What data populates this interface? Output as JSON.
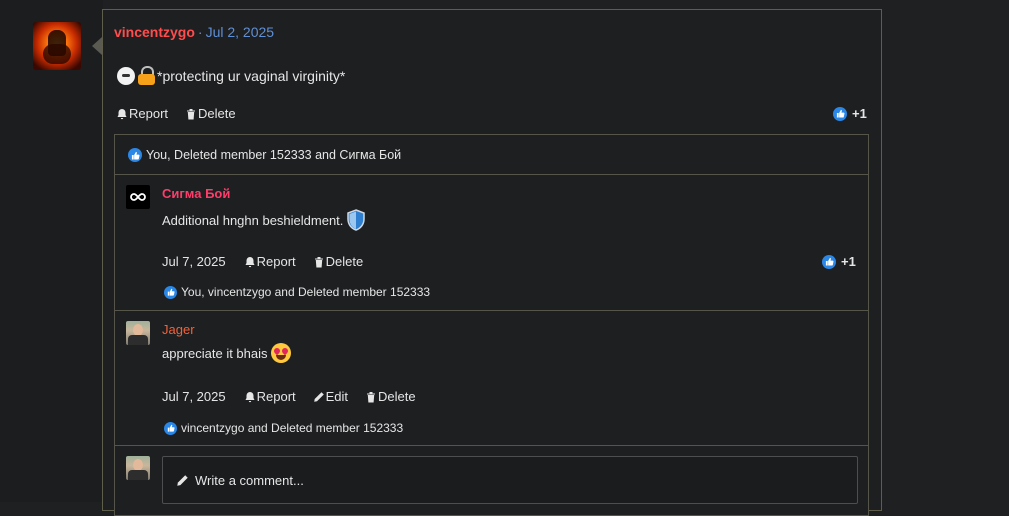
{
  "post": {
    "username": "vincentzygo",
    "separator": "·",
    "date": "Jul 2, 2025",
    "body_text": "*protecting ur vaginal virginity*",
    "actions": {
      "report": "Report",
      "delete": "Delete"
    },
    "reaction_count": "+1"
  },
  "reactions_bar": {
    "text": "You, Deleted member 152333 and Сигма Бой"
  },
  "comments": [
    {
      "username": "Сигма Бой",
      "username_color": "#ff3d6b",
      "text": "Additional hnghn beshieldment.",
      "date": "Jul 7, 2025",
      "report": "Report",
      "delete": "Delete",
      "reaction_count": "+1",
      "reactions_text": "You, vincentzygo and Deleted member 152333"
    },
    {
      "username": "Jager",
      "username_color": "#f0623a",
      "text": "appreciate it bhais",
      "date": "Jul 7, 2025",
      "report": "Report",
      "edit": "Edit",
      "delete": "Delete",
      "reactions_text": "vincentzygo and Deleted member 152333"
    }
  ],
  "comment_input": {
    "placeholder": "Write a comment..."
  },
  "colors": {
    "username": "#ff4d4d",
    "date": "#5f8fd6",
    "like": "#2b87e6",
    "border": "#55554a"
  },
  "icons": [
    "bell-icon",
    "trash-icon",
    "like-icon",
    "pencil-icon",
    "shield-icon",
    "lock-emoji",
    "heart-eyes-emoji"
  ]
}
